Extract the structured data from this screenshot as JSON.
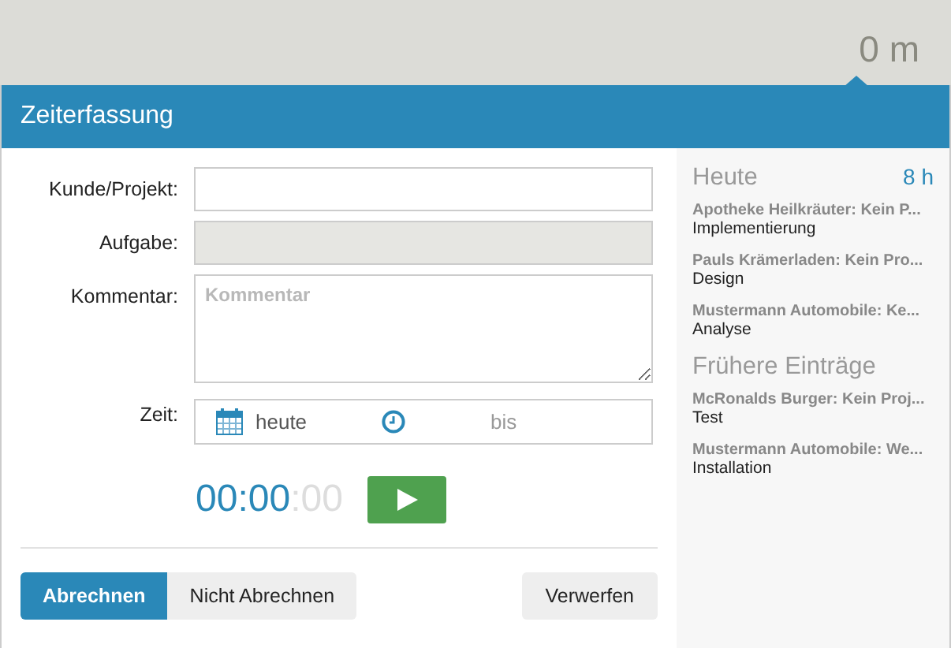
{
  "top_bar": {
    "duration": "0 m"
  },
  "window": {
    "title": "Zeiterfassung"
  },
  "form": {
    "fields": [
      {
        "kind": "input",
        "label": "Kunde/Projekt:",
        "disabled": false
      },
      {
        "kind": "input",
        "label": "Aufgabe:",
        "disabled": true
      },
      {
        "kind": "textarea",
        "label": "Kommentar:",
        "placeholder": "Kommentar",
        "disabled": false
      },
      {
        "kind": "time",
        "label": "Zeit:",
        "date": "heute",
        "until": "bis",
        "disabled": false
      }
    ],
    "timer": {
      "elapsed": "00:00",
      "seconds": ":00"
    },
    "billing": [
      {
        "label": "Abrechnen",
        "selected": true
      },
      {
        "label": "Nicht Abrechnen",
        "selected": false
      }
    ],
    "discard": "Verwerfen"
  },
  "sidebar": {
    "sections": [
      {
        "title": "Heute",
        "total": "8 h",
        "entries": [
          {
            "project": "Apotheke Heilkräuter: Kein P...",
            "task": "Implementierung"
          },
          {
            "project": "Pauls Krämerladen: Kein Pro...",
            "task": "Design"
          },
          {
            "project": "Mustermann Automobile: Ke...",
            "task": "Analyse"
          }
        ]
      },
      {
        "title": "Frühere Einträge",
        "entries": [
          {
            "project": "McRonalds Burger: Kein Proj...",
            "task": "Test"
          },
          {
            "project": "Mustermann Automobile: We...",
            "task": "Installation"
          }
        ]
      }
    ]
  }
}
